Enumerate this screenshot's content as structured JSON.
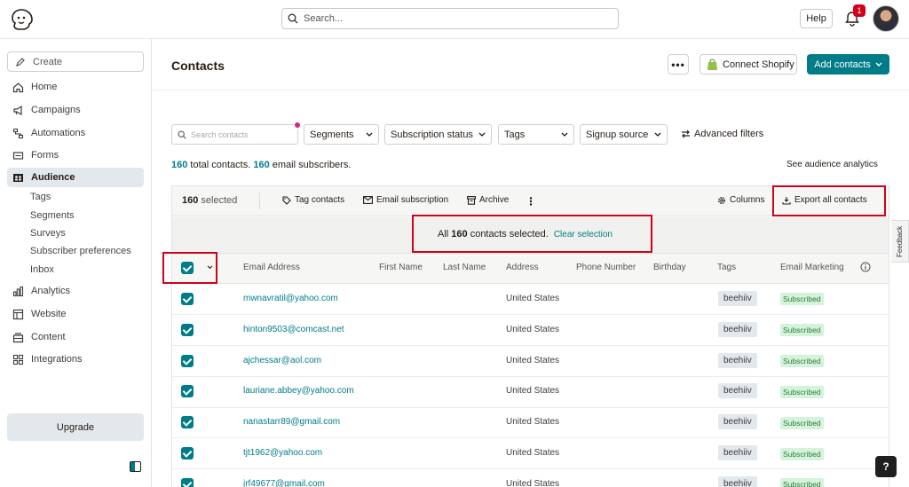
{
  "topbar": {
    "search_placeholder": "Search...",
    "help_label": "Help",
    "notification_count": "1"
  },
  "sidebar": {
    "create_label": "Create",
    "items": [
      {
        "label": "Home",
        "icon": "home-icon"
      },
      {
        "label": "Campaigns",
        "icon": "megaphone-icon"
      },
      {
        "label": "Automations",
        "icon": "flow-icon"
      },
      {
        "label": "Forms",
        "icon": "form-icon"
      },
      {
        "label": "Audience",
        "icon": "audience-icon",
        "active": true
      },
      {
        "label": "Analytics",
        "icon": "bar-chart-icon"
      },
      {
        "label": "Website",
        "icon": "website-icon"
      },
      {
        "label": "Content",
        "icon": "content-icon"
      },
      {
        "label": "Integrations",
        "icon": "grid-icon"
      }
    ],
    "audience_sub": [
      "Tags",
      "Segments",
      "Surveys",
      "Subscriber preferences",
      "Inbox"
    ],
    "upgrade_label": "Upgrade"
  },
  "header": {
    "title": "Contacts",
    "more_label": "•••",
    "shopify_label": "Connect Shopify",
    "add_contacts_label": "Add contacts"
  },
  "filters": {
    "search_placeholder": "Search contacts",
    "selects": [
      "Segments",
      "Subscription status",
      "Tags",
      "Signup source"
    ],
    "advanced_label": "Advanced filters"
  },
  "summary": {
    "total": "160",
    "total_text": " total contacts. ",
    "email": "160",
    "email_text": " email subscribers.",
    "see_analytics": "See audience analytics"
  },
  "toolbar": {
    "selected_count": "160",
    "selected_text": "selected",
    "tag_contacts": "Tag contacts",
    "email_subscription": "Email subscription",
    "archive": "Archive",
    "columns": "Columns",
    "export_all": "Export all contacts"
  },
  "banner": {
    "prefix": "All ",
    "count": "160",
    "suffix": " contacts selected.",
    "clear": "Clear selection"
  },
  "table": {
    "columns": [
      "Email Address",
      "First Name",
      "Last Name",
      "Address",
      "Phone Number",
      "Birthday",
      "Tags",
      "Email Marketing"
    ],
    "rows": [
      {
        "email": "mwnavratil@yahoo.com",
        "address": "United States",
        "tag": "beehiiv",
        "status": "Subscribed"
      },
      {
        "email": "hinton9503@comcast.net",
        "address": "United States",
        "tag": "beehiiv",
        "status": "Subscribed"
      },
      {
        "email": "ajchessar@aol.com",
        "address": "United States",
        "tag": "beehiiv",
        "status": "Subscribed"
      },
      {
        "email": "lauriane.abbey@yahoo.com",
        "address": "United States",
        "tag": "beehiiv",
        "status": "Subscribed"
      },
      {
        "email": "nanastarr89@gmail.com",
        "address": "United States",
        "tag": "beehiiv",
        "status": "Subscribed"
      },
      {
        "email": "tjt1962@yahoo.com",
        "address": "United States",
        "tag": "beehiiv",
        "status": "Subscribed"
      },
      {
        "email": "jrf49677@gmail.com",
        "address": "United States",
        "tag": "beehiiv",
        "status": "Subscribed"
      }
    ]
  },
  "feedback_label": "Feedback",
  "help_float": "?"
}
